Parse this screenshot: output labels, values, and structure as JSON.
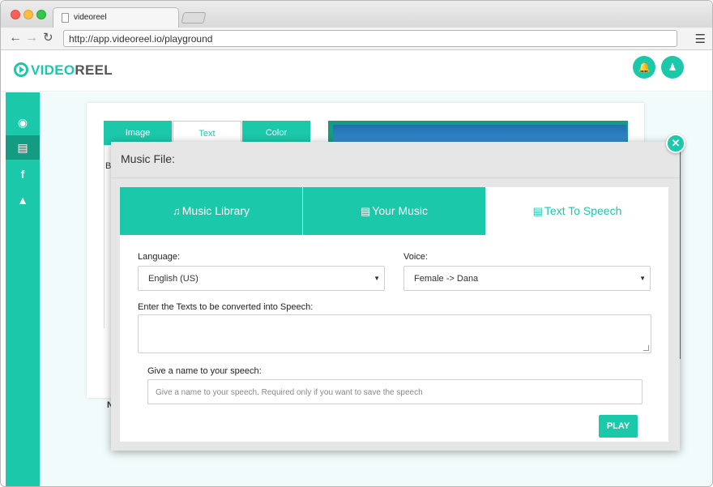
{
  "browser": {
    "tab_title": "videoreel",
    "url": "http://app.videoreel.io/playground",
    "back_icon": "arrow-left",
    "forward_icon": "arrow-right",
    "reload_icon": "reload",
    "menu_icon": "hamburger"
  },
  "app": {
    "logo_video": "VIDEO",
    "logo_reel": "REEL",
    "accent_color": "#1bc8a9",
    "dark_accent_color": "#149c83"
  },
  "sidebar": {
    "items": [
      {
        "icon": "dashboard-icon"
      },
      {
        "icon": "laptop-icon",
        "active": true
      },
      {
        "icon": "facebook-icon"
      },
      {
        "icon": "graduation-cap-icon"
      }
    ]
  },
  "background": {
    "tabs": [
      "Image",
      "Text",
      "Color"
    ],
    "fragments": [
      "B",
      "N"
    ]
  },
  "modal": {
    "title": "Music File:",
    "close_icon": "close-icon",
    "tabs": [
      {
        "label": "Music Library",
        "icon": "music-note-icon"
      },
      {
        "label": "Your Music",
        "icon": "audio-file-icon"
      },
      {
        "label": "Text To Speech",
        "icon": "text-file-icon",
        "active": true
      }
    ],
    "language_label": "Language:",
    "language_value": "English (US)",
    "voice_label": "Voice:",
    "voice_value": "Female -> Dana",
    "text_label": "Enter the Texts to be converted into Speech:",
    "text_value": "",
    "name_label": "Give a name to your speech:",
    "name_placeholder": "Give a name to your speech. Required only if you want to save the speech",
    "play_label": "PLAY"
  }
}
